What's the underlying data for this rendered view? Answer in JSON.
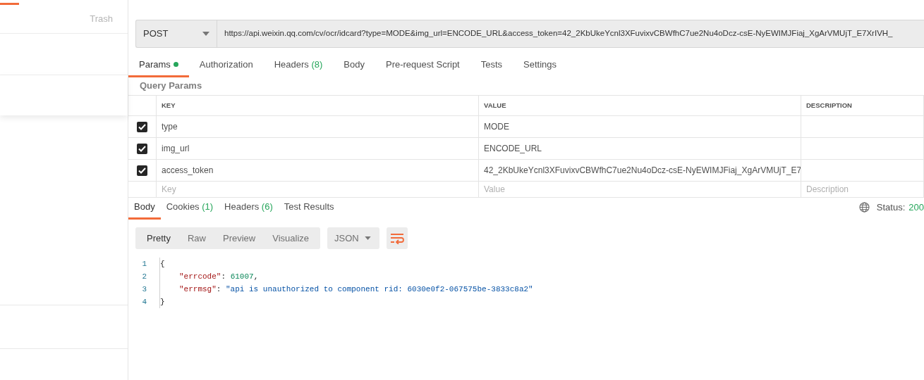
{
  "sidebar": {
    "trash_label": "Trash"
  },
  "request": {
    "method": "POST",
    "url": "https://api.weixin.qq.com/cv/ocr/idcard?type=MODE&img_url=ENCODE_URL&access_token=42_2KbUkeYcnl3XFuvixvCBWfhC7ue2Nu4oDcz-csE-NyEWIMJFiaj_XgArVMUjT_E7XrIVH_"
  },
  "request_tabs": [
    {
      "label": "Params",
      "selected": true,
      "dot": true
    },
    {
      "label": "Authorization",
      "selected": false
    },
    {
      "label": "Headers",
      "count": "(8)",
      "selected": false
    },
    {
      "label": "Body",
      "selected": false
    },
    {
      "label": "Pre-request Script",
      "selected": false
    },
    {
      "label": "Tests",
      "selected": false
    },
    {
      "label": "Settings",
      "selected": false
    }
  ],
  "query_params": {
    "title": "Query Params",
    "columns": [
      "KEY",
      "VALUE",
      "DESCRIPTION"
    ],
    "rows": [
      {
        "checked": true,
        "key": "type",
        "value": "MODE"
      },
      {
        "checked": true,
        "key": "img_url",
        "value": "ENCODE_URL"
      },
      {
        "checked": true,
        "key": "access_token",
        "value": "42_2KbUkeYcnl3XFuvixvCBWfhC7ue2Nu4oDcz-csE-NyEWIMJFiaj_XgArVMUjT_E7"
      }
    ],
    "new_row": {
      "key_placeholder": "Key",
      "value_placeholder": "Value",
      "description_placeholder": "Description"
    }
  },
  "response": {
    "tabs": [
      {
        "label": "Body",
        "selected": true
      },
      {
        "label": "Cookies",
        "count": "(1)",
        "selected": false
      },
      {
        "label": "Headers",
        "count": "(6)",
        "selected": false
      },
      {
        "label": "Test Results",
        "selected": false
      }
    ],
    "status_label": "Status:",
    "status_value": "200",
    "view_modes": [
      {
        "label": "Pretty",
        "selected": true
      },
      {
        "label": "Raw",
        "selected": false
      },
      {
        "label": "Preview",
        "selected": false
      },
      {
        "label": "Visualize",
        "selected": false
      }
    ],
    "format": "JSON",
    "code_lines": [
      {
        "number": "1",
        "indented": false,
        "tokens": [
          {
            "kind": "punct",
            "text": "{"
          }
        ]
      },
      {
        "number": "2",
        "indented": true,
        "tokens": [
          {
            "kind": "key",
            "text": "\"errcode\""
          },
          {
            "kind": "punct",
            "text": ": "
          },
          {
            "kind": "number",
            "text": "61007"
          },
          {
            "kind": "punct",
            "text": ","
          }
        ]
      },
      {
        "number": "3",
        "indented": true,
        "tokens": [
          {
            "kind": "key",
            "text": "\"errmsg\""
          },
          {
            "kind": "punct",
            "text": ": "
          },
          {
            "kind": "string",
            "text": "\"api is unauthorized to component rid: 6030e0f2-067575be-3833c8a2\""
          }
        ]
      },
      {
        "number": "4",
        "indented": false,
        "tokens": [
          {
            "kind": "punct",
            "text": "}"
          }
        ]
      }
    ]
  }
}
